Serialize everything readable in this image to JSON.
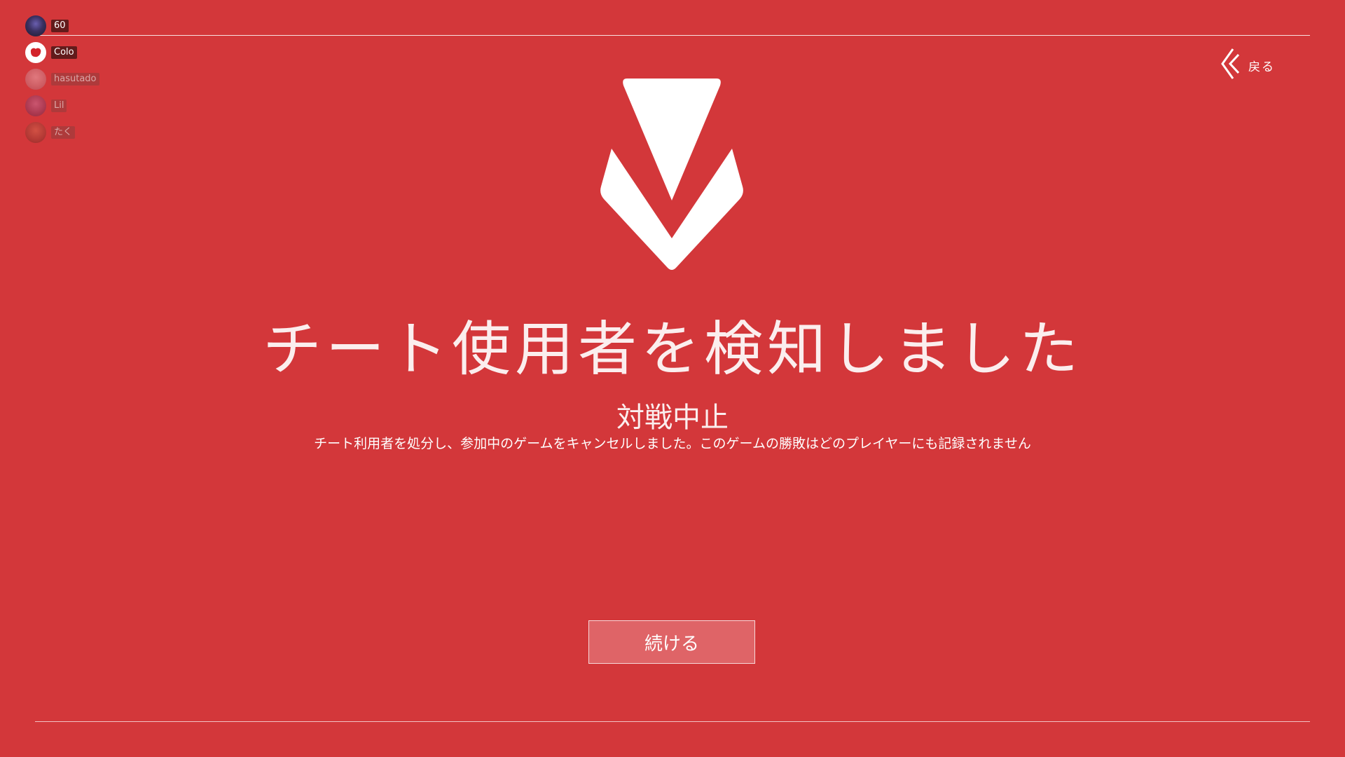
{
  "party": {
    "members": [
      {
        "name": "60",
        "avatar_icon": "avatar-dark-character",
        "avatar_color": "#2b2740",
        "active": true
      },
      {
        "name": "Colo",
        "avatar_icon": "avatar-red-blob",
        "avatar_color": "#ffffff",
        "active": true
      },
      {
        "name": "hasutado",
        "avatar_icon": "avatar-pink-character",
        "avatar_color": "#c88c96",
        "active": false
      },
      {
        "name": "Lil",
        "avatar_icon": "avatar-purple-character",
        "avatar_color": "#8a4a78",
        "active": false
      },
      {
        "name": "たく",
        "avatar_icon": "avatar-brown-character",
        "avatar_color": "#8b3b2e",
        "active": false
      }
    ]
  },
  "back": {
    "label": "戻る",
    "icon": "double-chevron-left-icon"
  },
  "emblem": {
    "icon": "valorant-logo-icon"
  },
  "message": {
    "title": "チート使用者を検知しました",
    "subtitle": "対戦中止",
    "description": "チート利用者を処分し、参加中のゲームをキャンセルしました。このゲームの勝敗はどのプレイヤーにも記録されません"
  },
  "continue_button": {
    "label": "続ける"
  },
  "colors": {
    "background": "#d3373a",
    "button": "#df6467",
    "text": "#ffffff"
  }
}
